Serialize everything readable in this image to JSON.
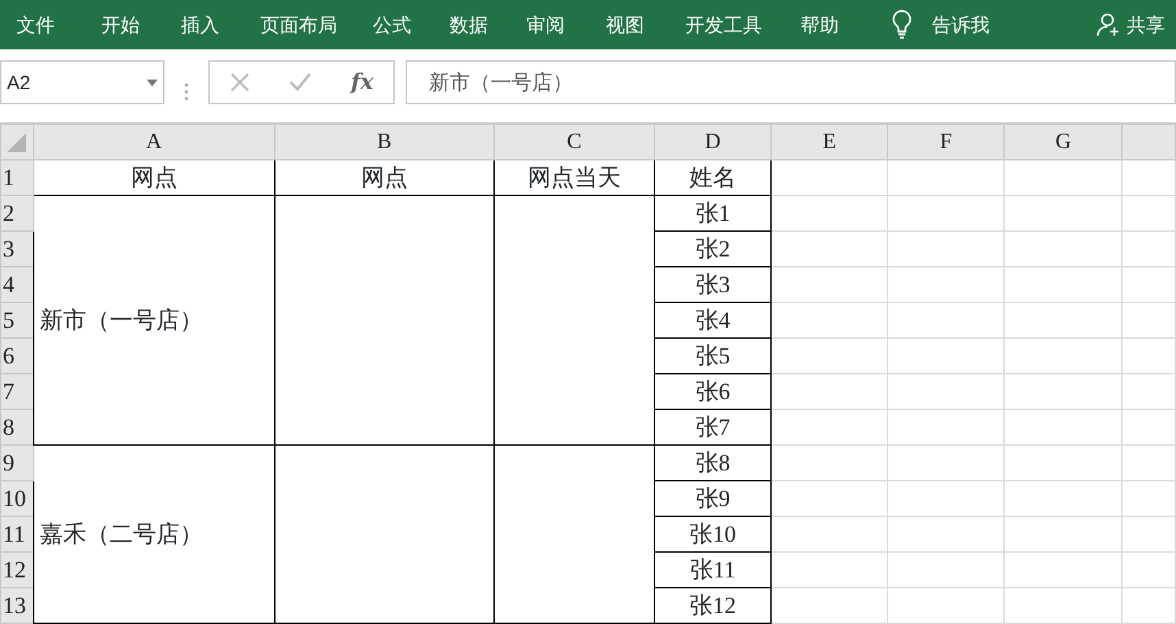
{
  "ribbon": {
    "tabs": [
      {
        "label": "文件"
      },
      {
        "label": "开始"
      },
      {
        "label": "插入"
      },
      {
        "label": "页面布局"
      },
      {
        "label": "公式"
      },
      {
        "label": "数据"
      },
      {
        "label": "审阅"
      },
      {
        "label": "视图"
      },
      {
        "label": "开发工具"
      },
      {
        "label": "帮助"
      }
    ],
    "tell_me": "告诉我",
    "share": "共享"
  },
  "formula_bar": {
    "name_box": "A2",
    "function_label": "fx",
    "content": "新市（一号店）"
  },
  "sheet": {
    "columns": [
      "A",
      "B",
      "C",
      "D",
      "E",
      "F",
      "G"
    ],
    "rows": [
      "1",
      "2",
      "3",
      "4",
      "5",
      "6",
      "7",
      "8",
      "9",
      "10",
      "11",
      "12",
      "13"
    ],
    "header": [
      "网点",
      "网点",
      "网点当天",
      "姓名"
    ],
    "groups": [
      {
        "store": "新市（一号店）",
        "names": [
          "张1",
          "张2",
          "张3",
          "张4",
          "张5",
          "张6",
          "张7"
        ]
      },
      {
        "store": "嘉禾（二号店）",
        "names": [
          "张8",
          "张9",
          "张10",
          "张11",
          "张12"
        ]
      }
    ]
  }
}
